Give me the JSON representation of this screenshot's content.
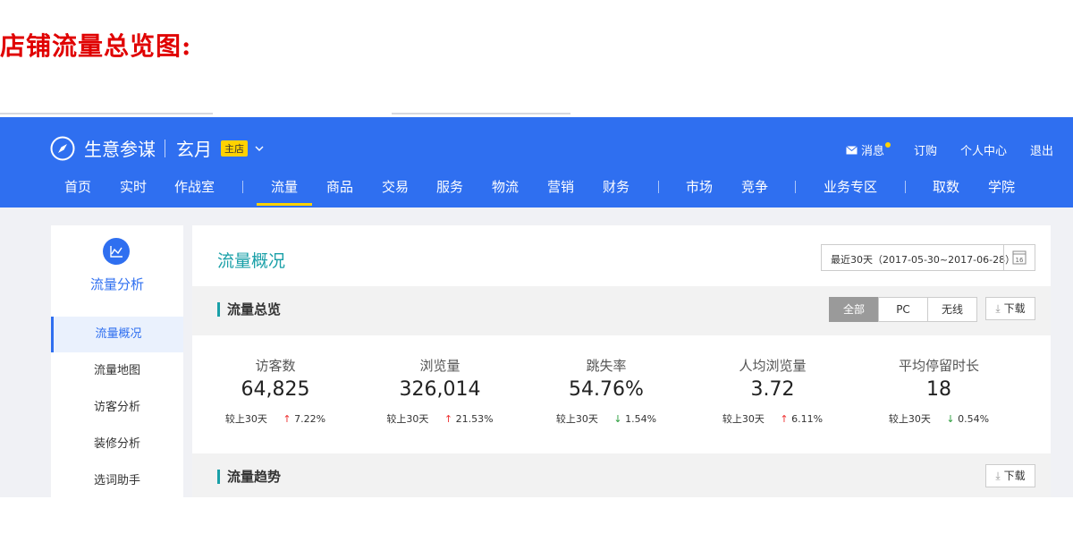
{
  "caption": "店铺流量总览图:",
  "header": {
    "brand_name": "生意参谋",
    "shop_name": "玄月",
    "shop_badge": "主店",
    "top_links": [
      "消息",
      "订购",
      "个人中心",
      "退出"
    ],
    "nav": [
      "首页",
      "实时",
      "作战室",
      "流量",
      "商品",
      "交易",
      "服务",
      "物流",
      "营销",
      "财务",
      "市场",
      "竞争",
      "业务专区",
      "取数",
      "学院"
    ],
    "active_nav": "流量",
    "accent": "#2f6ff0",
    "badge_color": "#ffd200"
  },
  "sidebar": {
    "title": "流量分析",
    "items": [
      "流量概况",
      "流量地图",
      "访客分析",
      "装修分析",
      "选词助手"
    ],
    "active": "流量概况"
  },
  "main": {
    "title": "流量概况",
    "date_range": "最近30天（2017-05-30~2017-06-28）",
    "calendar_day": "16",
    "overview": {
      "title": "流量总览",
      "filters": [
        "全部",
        "PC",
        "无线"
      ],
      "active_filter": "全部",
      "download_label": "下载",
      "metrics": [
        {
          "label": "访客数",
          "value": "64,825",
          "cmp_label": "较上30天",
          "change": "7.22%",
          "dir": "up"
        },
        {
          "label": "浏览量",
          "value": "326,014",
          "cmp_label": "较上30天",
          "change": "21.53%",
          "dir": "up"
        },
        {
          "label": "跳失率",
          "value": "54.76%",
          "cmp_label": "较上30天",
          "change": "1.54%",
          "dir": "down"
        },
        {
          "label": "人均浏览量",
          "value": "3.72",
          "cmp_label": "较上30天",
          "change": "6.11%",
          "dir": "up"
        },
        {
          "label": "平均停留时长",
          "value": "18",
          "cmp_label": "较上30天",
          "change": "0.54%",
          "dir": "down"
        }
      ]
    },
    "trend": {
      "title": "流量趋势",
      "download_label": "下载"
    }
  }
}
